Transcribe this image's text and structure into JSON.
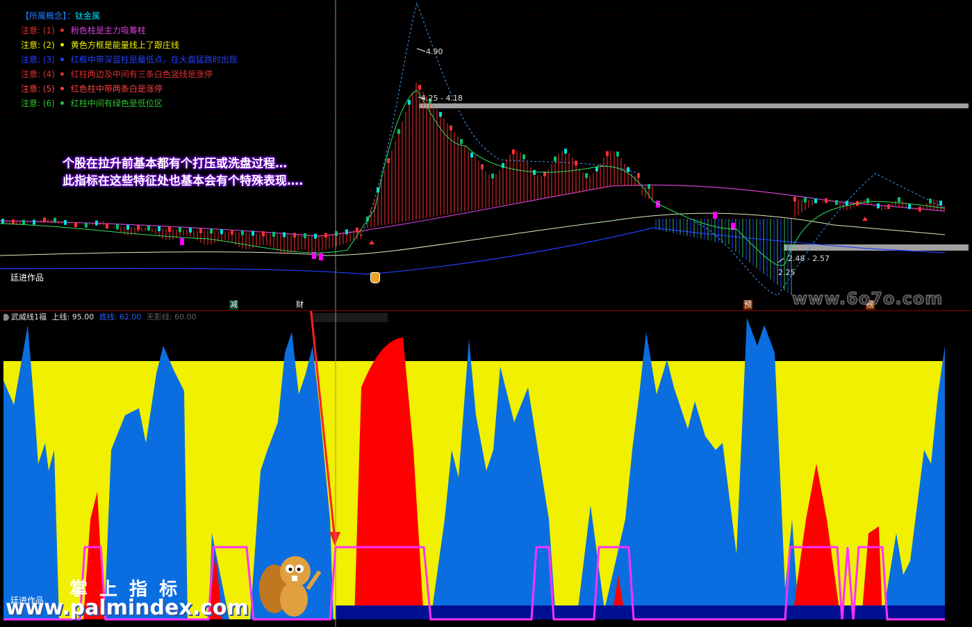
{
  "concept": {
    "label": "【所属概念】：",
    "value": "钛金属"
  },
  "notes": [
    {
      "prefix": "注意: (1)",
      "text": "粉色柱是主力吸筹柱",
      "color": "#e040e0",
      "prefix_color": "#e03030"
    },
    {
      "prefix": "注意: (2)",
      "text": "黄色方框是能量线上了跟庄线",
      "color": "#f0f000",
      "prefix_color": "#f0f000"
    },
    {
      "prefix": "注意: (3)",
      "text": "红框中带深蓝柱是最低点，在大盘猛跌时出现",
      "color": "#2040ff",
      "prefix_color": "#2040ff"
    },
    {
      "prefix": "注意: (4)",
      "text": "红柱两边及中间有三条白色竖线是涨停",
      "color": "#e03030",
      "prefix_color": "#e03030"
    },
    {
      "prefix": "注意: (5)",
      "text": "红色柱中带两条白是涨停",
      "color": "#ff4040",
      "prefix_color": "#ff4040"
    },
    {
      "prefix": "注意: (6)",
      "text": "红柱中间有绿色是低位区",
      "color": "#30c030",
      "prefix_color": "#30c030"
    }
  ],
  "callout": {
    "line1": "个股在拉升前基本都有个打压或洗盘过程…",
    "line2": "此指标在这些特征处也基本会有个特殊表现…."
  },
  "price_labels": {
    "peak": "4.90",
    "range_high": "4.25 - 4.18",
    "range_low": "2.48 - 2.57",
    "low": "2.25"
  },
  "author_top": "廷进作品",
  "author_bottom": "廷进作品",
  "event_tags": [
    "减",
    "财",
    "预",
    "榜"
  ],
  "indicator": {
    "name": "武威线1福",
    "upper_label": "上线: 95.00",
    "bottom_label": "底线: 62.00",
    "safe_label": "无影线: 60.00"
  },
  "watermarks": {
    "site_right": "www.6o7o.com",
    "palm_title": "掌 上 指 标",
    "palm_url": "www.palmindex.com"
  },
  "colors": {
    "up": "#ff3030",
    "down": "#00e0e0",
    "pink_bar": "#ff00ff",
    "yellow_area": "#f0f000",
    "blue_area": "#0a6ee0",
    "red_area": "#ff0000",
    "navy_base": "#001090",
    "magenta_line": "#ff30ff",
    "gray_zone": "#a0a0a0"
  }
}
